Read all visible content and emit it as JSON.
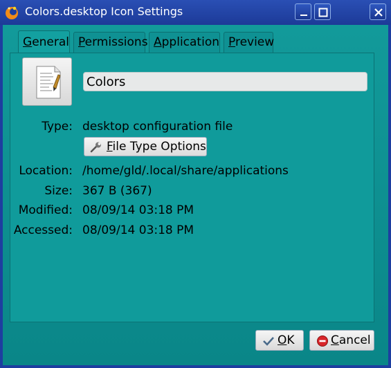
{
  "window": {
    "title": "Colors.desktop Icon Settings"
  },
  "tabs": [
    {
      "first": "G",
      "rest": "eneral"
    },
    {
      "first": "P",
      "rest": "ermissions"
    },
    {
      "first": "A",
      "rest": "pplication"
    },
    {
      "first": "P",
      "rest": "review"
    }
  ],
  "general": {
    "name_value": "Colors",
    "type_label": "Type:",
    "type_value": "desktop configuration file",
    "file_type_button": {
      "first": "F",
      "rest": "ile Type Options"
    },
    "location_label": "Location:",
    "location_value": "/home/gld/.local/share/applications",
    "size_label": "Size:",
    "size_value": "367 B (367)",
    "modified_label": "Modified:",
    "modified_value": "08/09/14 03:18 PM",
    "accessed_label": "Accessed:",
    "accessed_value": "08/09/14 03:18 PM"
  },
  "buttons": {
    "ok": {
      "first": "O",
      "rest": "K"
    },
    "cancel": {
      "first": "C",
      "rest": "ancel"
    }
  },
  "colors": {
    "titlebar": "#1d3ea0",
    "client": "#109b9b"
  },
  "icons": [
    "app-icon",
    "minimize-icon",
    "maximize-icon",
    "close-icon",
    "document-icon",
    "wrench-icon",
    "check-icon",
    "cancel-icon"
  ]
}
